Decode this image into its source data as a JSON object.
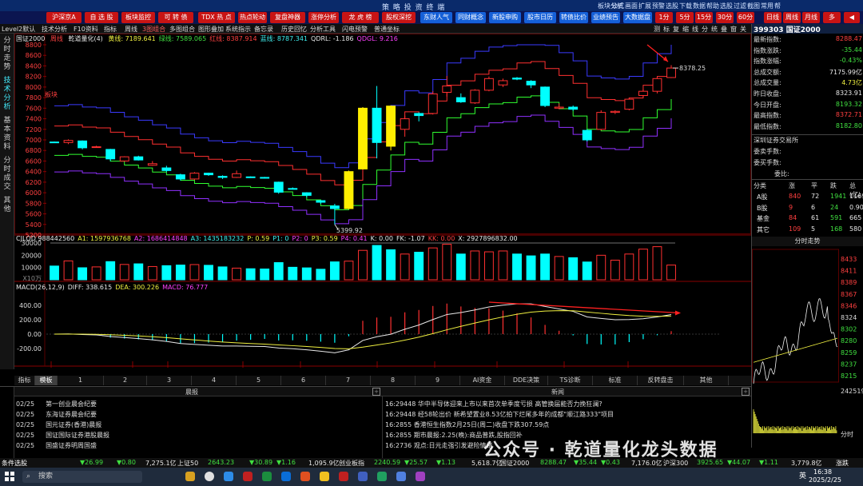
{
  "window": {
    "title": "策 略 投 资 终 端",
    "menus": [
      "板块分析",
      "公式",
      "画面",
      "扩展",
      "预警",
      "选股",
      "下载",
      "数据",
      "帮助",
      "选股",
      "过滤",
      "截图",
      "常用",
      "帮",
      "",
      "",
      "",
      ""
    ]
  },
  "nav": {
    "items": [
      "沪深京A",
      "自 选 股",
      "板块监控",
      "可 转 债",
      "TDX 热 点",
      "热点轮动",
      "复盘神器",
      "涨停分析",
      "龙 虎 榜",
      "股权深挖",
      "东财人气",
      "同财概念",
      "新股申购",
      "股市日历",
      "转债比价",
      "业绩预告",
      "大数据盘",
      "1分",
      "5分",
      "15分",
      "30分",
      "60分",
      "日线",
      "周线",
      "月线",
      "多"
    ]
  },
  "toolbar": {
    "items": [
      "Level2默认",
      "技术分析",
      "F10资料",
      "指标",
      "周线",
      "3图组合",
      "多图组合",
      "图形叠加",
      "系统指示",
      "备忘录",
      "历史回忆",
      "分析工具",
      "闪电预警",
      "普通坐标"
    ],
    "right": [
      "测",
      "标",
      "复",
      "缩",
      "线",
      "分",
      "统",
      "叠",
      "窗",
      "关"
    ]
  },
  "lefttabs": [
    "分时走势",
    "技术分析",
    "基本资料",
    "分时成交",
    "其他"
  ],
  "chart": {
    "name": "国证2000",
    "legend": {
      "name": "国证2000",
      "period": "周线",
      "indicator": "乾道量化(4)",
      "items": [
        {
          "k": "黄线:",
          "v": "7189.641"
        },
        {
          "k": "绿线:",
          "v": "7589.065"
        },
        {
          "k": "红线:",
          "v": "8387.914"
        },
        {
          "k": "蓝线:",
          "v": "8787.341"
        },
        {
          "k": "QDRL:",
          "v": "-1.186"
        },
        {
          "k": "QDGL:",
          "v": "9.216"
        }
      ]
    },
    "price_axis": [
      "8800",
      "8600",
      "8400",
      "8200",
      "8000",
      "7800",
      "7600",
      "7400",
      "7200",
      "7000",
      "6800",
      "6600",
      "6400",
      "6200",
      "6000",
      "5800",
      "5600",
      "5400",
      "5200"
    ],
    "annotations": {
      "high": "8378.25",
      "low": "5399.92",
      "tag": "板块"
    },
    "vol_legend": {
      "title": "CJLQD",
      "v": "988442560",
      "items": [
        {
          "k": "A1:",
          "v": "1597936768"
        },
        {
          "k": "A2:",
          "v": "1686414848"
        },
        {
          "k": "A3:",
          "v": "1435183232"
        },
        {
          "k": "P:",
          "v": "0.59"
        },
        {
          "k": "P1:",
          "v": "0"
        },
        {
          "k": "P2:",
          "v": "0"
        },
        {
          "k": "P3:",
          "v": "0.59"
        },
        {
          "k": "P4:",
          "v": "0.41"
        },
        {
          "k": "K:",
          "v": "0.00"
        },
        {
          "k": "FK:",
          "v": "-1.07"
        },
        {
          "k": "KK:",
          "v": "0.00"
        },
        {
          "k": "X:",
          "v": "2927896832.00"
        }
      ]
    },
    "vol_axis": [
      "30000",
      "20000",
      "10000",
      "X10万"
    ],
    "macd_legend": {
      "title": "MACD(26,12,9)",
      "items": [
        {
          "k": "DIFF:",
          "v": "338.615"
        },
        {
          "k": "DEA:",
          "v": "300.226"
        },
        {
          "k": "MACD:",
          "v": "76.777"
        }
      ]
    },
    "macd_axis": [
      "400.00",
      "200.00",
      "0.00",
      "-200.00"
    ],
    "date_axis": [
      "2024/05",
      "06",
      "07",
      "08",
      "09",
      "10",
      "11",
      "12",
      "2025/01",
      "02"
    ]
  },
  "chart_data": {
    "type": "candlestick",
    "period": "weekly",
    "candles": [
      [
        6960,
        6970,
        6940,
        6950
      ],
      [
        6950,
        7010,
        6920,
        6990
      ],
      [
        6980,
        6990,
        6820,
        6850
      ],
      [
        6870,
        6890,
        6850,
        6870
      ],
      [
        6820,
        6830,
        6600,
        6640
      ],
      [
        6600,
        6690,
        6590,
        6680
      ],
      [
        6680,
        6700,
        6610,
        6620
      ],
      [
        6520,
        6600,
        6510,
        6550
      ],
      [
        6470,
        6510,
        6390,
        6420
      ],
      [
        6340,
        6360,
        6230,
        6260
      ],
      [
        6260,
        6390,
        6240,
        6370
      ],
      [
        6370,
        6380,
        6320,
        6340
      ],
      [
        6310,
        6330,
        6260,
        6290
      ],
      [
        6290,
        6420,
        6280,
        6360
      ],
      [
        6300,
        6310,
        6280,
        6290
      ],
      [
        6290,
        6300,
        6270,
        6280
      ],
      [
        6200,
        6210,
        5980,
        6010
      ],
      [
        6080,
        6100,
        6060,
        6070
      ],
      [
        6000,
        6010,
        5910,
        5950
      ],
      [
        5850,
        5860,
        5790,
        5820
      ],
      [
        5750,
        5790,
        5400,
        5700
      ],
      [
        5700,
        6420,
        5690,
        6400
      ],
      [
        6450,
        7620,
        6440,
        7600
      ],
      [
        7600,
        8020,
        6650,
        6950
      ],
      [
        7640,
        7650,
        6800,
        6880
      ],
      [
        7200,
        7460,
        7060,
        7400
      ],
      [
        7500,
        7520,
        7350,
        7460
      ],
      [
        7500,
        7920,
        7480,
        7870
      ],
      [
        7900,
        8210,
        7820,
        8020
      ],
      [
        7800,
        7880,
        7700,
        7720
      ],
      [
        7700,
        7960,
        7680,
        7940
      ],
      [
        7940,
        8200,
        7920,
        8160
      ],
      [
        8040,
        8160,
        8000,
        8120
      ],
      [
        8170,
        8190,
        8130,
        8150
      ],
      [
        8110,
        8130,
        7980,
        8040
      ],
      [
        8000,
        8010,
        7620,
        7650
      ],
      [
        7600,
        7690,
        7580,
        7620
      ],
      [
        7620,
        7650,
        7550,
        7580
      ],
      [
        7180,
        7200,
        6970,
        7000
      ],
      [
        7200,
        7560,
        7180,
        7520
      ],
      [
        7520,
        7560,
        7490,
        7540
      ],
      [
        7580,
        7800,
        7560,
        7770
      ],
      [
        7840,
        7960,
        7800,
        7920
      ],
      [
        7920,
        8180,
        7880,
        8160
      ],
      [
        8180,
        8380,
        8170,
        8360
      ]
    ],
    "lines": {
      "blue_upper": "8787.341",
      "red": "8387.914",
      "green": "7589.065",
      "purple_lower": "7189.641"
    },
    "volume_x10w": [
      11200,
      15400,
      9800,
      10500,
      14800,
      12500,
      13000,
      10800,
      11500,
      12000,
      12400,
      11800,
      10500,
      9500,
      9000,
      8800,
      14000,
      10200,
      9700,
      8600,
      14600,
      15200,
      24000,
      28000,
      24500,
      21000,
      22500,
      26000,
      29000,
      21000,
      23500,
      22800,
      23500,
      21000,
      19500,
      21000,
      19000,
      18000,
      14500,
      20000,
      16000,
      21000,
      25000,
      27000,
      12000
    ],
    "macd": {
      "diff": "338.615",
      "dea": "300.226",
      "macd": "76.777"
    }
  },
  "right_panel": {
    "header": "399303 国证2000",
    "rows": [
      {
        "k": "最新指数:",
        "v": "8288.47",
        "c": "up"
      },
      {
        "k": "指数涨跌:",
        "v": "-35.44",
        "c": "dn"
      },
      {
        "k": "指数涨幅:",
        "v": "-0.43%",
        "c": "dn"
      },
      {
        "k": "总成交额:",
        "v": "7175.99亿",
        "c": "wh"
      },
      {
        "k": "总成交量:",
        "v": "4.73亿",
        "c": "yl"
      },
      {
        "k": "昨日收盘:",
        "v": "8323.91",
        "c": "wh"
      },
      {
        "k": "今日开盘:",
        "v": "8193.32",
        "c": "dn"
      },
      {
        "k": "最高指数:",
        "v": "8372.71",
        "c": "up"
      },
      {
        "k": "最低指数:",
        "v": "8182.80",
        "c": "dn"
      }
    ],
    "exchange": "深圳证券交易所",
    "rows2": [
      "委卖手数:",
      "委买手数:",
      "委比:"
    ],
    "breadth_head": [
      "分类",
      "涨",
      "平",
      "跌",
      "总(亿)"
    ],
    "breadth": [
      [
        "A股",
        "840",
        "72",
        "1941",
        "11692"
      ],
      [
        "B股",
        "9",
        "6",
        "24",
        "0.901"
      ],
      [
        "基金",
        "84",
        "61",
        "591",
        "665"
      ],
      [
        "其它",
        "109",
        "5",
        "168",
        "580"
      ]
    ],
    "intraday_title": "分时走势",
    "intraday_axis": [
      "8433",
      "8411",
      "8389",
      "8367",
      "8346",
      "8324",
      "8302",
      "8280",
      "8259",
      "8237",
      "8215"
    ],
    "intraday_vol": "242519",
    "intraday_label": "分时"
  },
  "bottom_tabs": [
    "指标",
    "模板",
    "1",
    "2",
    "3",
    "4",
    "5",
    "6",
    "7",
    "8",
    "9",
    "AI资金",
    "DDE决策",
    "TS诊断",
    "标准",
    "反转盘击",
    "其他"
  ],
  "news": {
    "left_title": "晨报",
    "right_title": "新闻",
    "left": [
      {
        "d": "02/25",
        "t": "第一创业晨会纪要"
      },
      {
        "d": "02/25",
        "t": "东海证券晨会纪要"
      },
      {
        "d": "02/25",
        "t": "国元证券(香港)晨报"
      },
      {
        "d": "02/25",
        "t": "国证国际证券港股晨报"
      },
      {
        "d": "02/25",
        "t": "国盛证券明周国盛"
      }
    ],
    "right": [
      "16:29448 华中半导体迎来上市以来首次单季度亏损 高管换届能否力挽狂澜?",
      "16:29448 经58轮出价 新希望置业8.53亿拍下烂尾多年的成都\"顺江路333\"项目",
      "16:2855 香港恒生指数2月25日(周二)收盘下跌307.59点",
      "16:2855 期市晨报:2.25(晚):商品普跌,股指回补",
      "16:2736 观点:日元走强引发避险情绪"
    ]
  },
  "ticker": [
    {
      "t": "▼26.99",
      "c": "dn"
    },
    {
      "t": "▼0.80",
      "c": "dn"
    },
    {
      "t": "7,275.1亿",
      "c": "wh"
    },
    {
      "t": "上证50",
      "c": "wh"
    },
    {
      "t": "2643.23",
      "c": "dn"
    },
    {
      "t": "▼30.89",
      "c": "dn"
    },
    {
      "t": "▼1.16",
      "c": "dn"
    },
    {
      "t": "1,095.9亿",
      "c": "wh"
    },
    {
      "t": "创业板指",
      "c": "wh"
    },
    {
      "t": "2240.59",
      "c": "dn"
    },
    {
      "t": "▼25.57",
      "c": "dn"
    },
    {
      "t": "▼1.13",
      "c": "dn"
    },
    {
      "t": "5,618.7亿",
      "c": "wh"
    },
    {
      "t": "国证2000",
      "c": "wh"
    },
    {
      "t": "8288.47",
      "c": "dn"
    },
    {
      "t": "▼35.44",
      "c": "dn"
    },
    {
      "t": "▼0.43",
      "c": "dn"
    },
    {
      "t": "7,176.0亿",
      "c": "wh"
    },
    {
      "t": "沪深300",
      "c": "wh"
    },
    {
      "t": "3925.65",
      "c": "dn"
    },
    {
      "t": "▼44.07",
      "c": "dn"
    },
    {
      "t": "▼1.11",
      "c": "dn"
    },
    {
      "t": "3,779.8亿",
      "c": "wh"
    }
  ],
  "status": {
    "left": "条件选股",
    "right": "涨跌"
  },
  "taskbar": {
    "search": "搜索",
    "time": "16:38",
    "date": "2025/2/25",
    "lang": "英"
  },
  "watermark": "公众号 · 乾道量化龙头数据"
}
